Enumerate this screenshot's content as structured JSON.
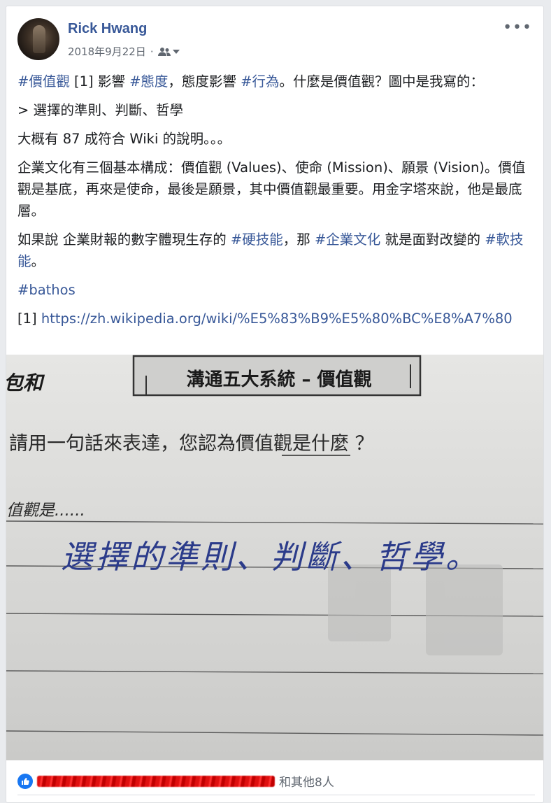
{
  "post": {
    "author": "Rick Hwang",
    "date": "2018年9月22日",
    "separator": "·",
    "more_label": "•••",
    "paragraphs": {
      "p1": {
        "tag1": "#價值觀",
        "text1": " [1] 影響 ",
        "tag2": "#態度",
        "text2": "，態度影響 ",
        "tag3": "#行為",
        "text3": "。什麼是價值觀？圖中是我寫的："
      },
      "p2": "> 選擇的準則、判斷、哲學",
      "p3": "大概有 87 成符合 Wiki 的說明。。。",
      "p4": "企業文化有三個基本構成：價值觀 (Values)、使命 (Mission)、願景 (Vision)。價值觀是基底，再來是使命，最後是願景，其中價值觀最重要。用金字塔來說，他是最底層。",
      "p5": {
        "text1": "如果說 企業財報的數字體現生存的 ",
        "tag1": "#硬技能",
        "text2": "，那 ",
        "tag2": "#企業文化",
        "text3": " 就是面對改變的 ",
        "tag3": "#軟技能",
        "text4": "。"
      },
      "p6_tag": "#bathos",
      "p7": {
        "ref": "[1] ",
        "url": "https://zh.wikipedia.org/wiki/%E5%83%B9%E5%80%BC%E8%A7%80"
      }
    },
    "photo": {
      "corner_text": "包和",
      "box_title": "溝通五大系統 – 價值觀",
      "question": "請用一句話來表達，您認為價值觀是什麼 ？",
      "prompt": "值觀是......",
      "handwriting": "選擇的準則、判斷、哲學。"
    },
    "footer": {
      "likes_suffix": "和其他8人"
    }
  },
  "colors": {
    "link": "#385898",
    "like_blue": "#1877f2",
    "redaction": "#e01010",
    "ink": "#2b3b8a"
  },
  "icons": {
    "audience": "friends-icon",
    "more": "more-options-icon",
    "like": "like-icon"
  }
}
